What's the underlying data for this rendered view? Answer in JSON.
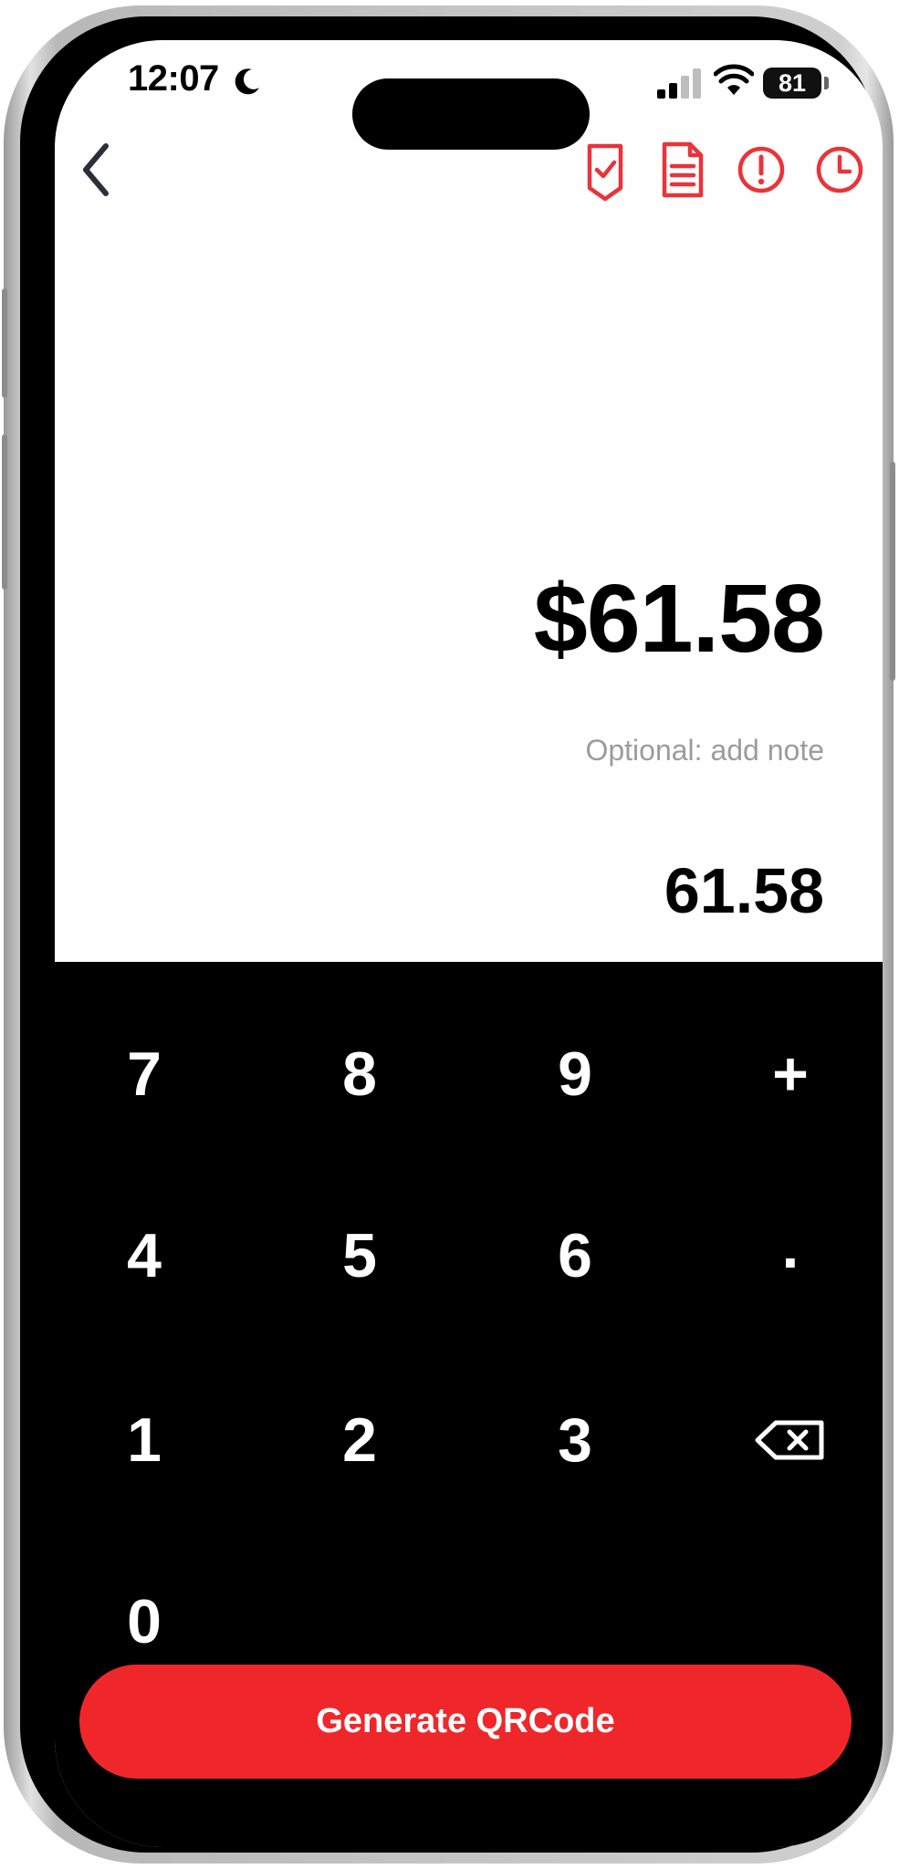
{
  "status_bar": {
    "time": "12:07",
    "battery": "81"
  },
  "nav": {
    "icons": [
      "back-chevron-icon",
      "receipt-check-icon",
      "document-icon",
      "alert-circle-icon",
      "clock-icon"
    ],
    "accent_color": "#e8343a"
  },
  "amount": {
    "display": "$61.58",
    "expression": "61.58",
    "note_placeholder": "Optional: add note"
  },
  "keypad": {
    "rows": [
      [
        "7",
        "8",
        "9",
        "+"
      ],
      [
        "4",
        "5",
        "6",
        "."
      ],
      [
        "1",
        "2",
        "3",
        "backspace"
      ],
      [
        "0"
      ]
    ],
    "background": "#000000"
  },
  "actions": {
    "generate_label": "Generate QRCode",
    "button_color": "#ef272a"
  }
}
